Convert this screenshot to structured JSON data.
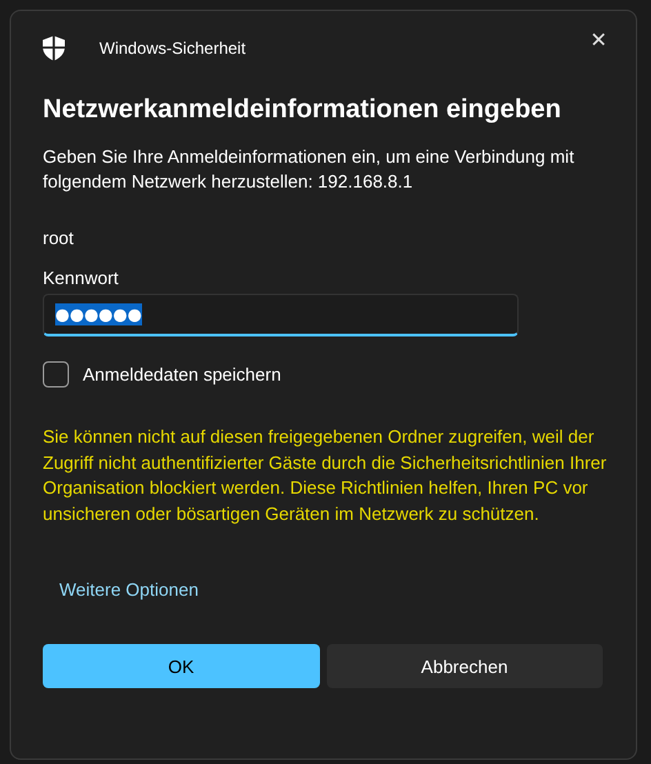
{
  "window": {
    "title": "Windows-Sicherheit",
    "close": "✕"
  },
  "heading": "Netzwerkanmeldeinformationen eingeben",
  "description": "Geben Sie Ihre Anmeldeinformationen ein, um eine Verbindung mit folgendem Netzwerk herzustellen: 192.168.8.1",
  "username": "root",
  "password": {
    "label": "Kennwort",
    "value": "●●●●●●",
    "focused": true
  },
  "remember": {
    "label": "Anmeldedaten speichern",
    "checked": false
  },
  "warning": "Sie können nicht auf diesen freigegebenen Ordner zugreifen, weil der Zugriff nicht authentifizierter Gäste durch die Sicherheitsrichtlinien Ihrer Organisation blockiert werden. Diese Richtlinien helfen, Ihren PC vor unsicheren oder bösartigen Geräten im Netzwerk zu schützen.",
  "more_options": "Weitere Optionen",
  "buttons": [
    {
      "label": "OK",
      "kind": "primary"
    },
    {
      "label": "Abbrechen",
      "kind": "secondary"
    }
  ]
}
